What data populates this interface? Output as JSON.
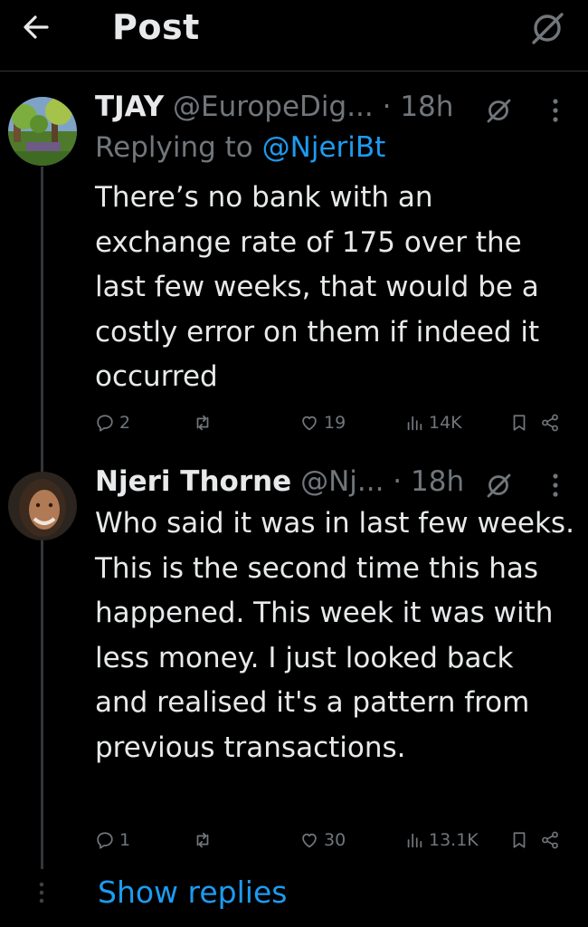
{
  "header": {
    "title": "Post"
  },
  "tweets": [
    {
      "name": "TJAY",
      "handle": "@EuropeDig...",
      "time": "· 18h",
      "replying_label": "Replying to",
      "replying_handle": "@NjeriBt",
      "text": "There’s no bank with an exchange rate of 175 over the last few weeks, that would be a costly error on them if indeed it occurred",
      "replies": "2",
      "retweets": "",
      "likes": "19",
      "views": "14K"
    },
    {
      "name": "Njeri Thorne",
      "handle": "@Nj...",
      "time": "· 18h",
      "text": "Who said it was in last few weeks. This is the second time this has happened. This week it was with less money. I just looked back and realised it's a pattern from previous transactions.",
      "replies": "1",
      "retweets": "",
      "likes": "30",
      "views": "13.1K"
    }
  ],
  "show_replies": "Show replies"
}
